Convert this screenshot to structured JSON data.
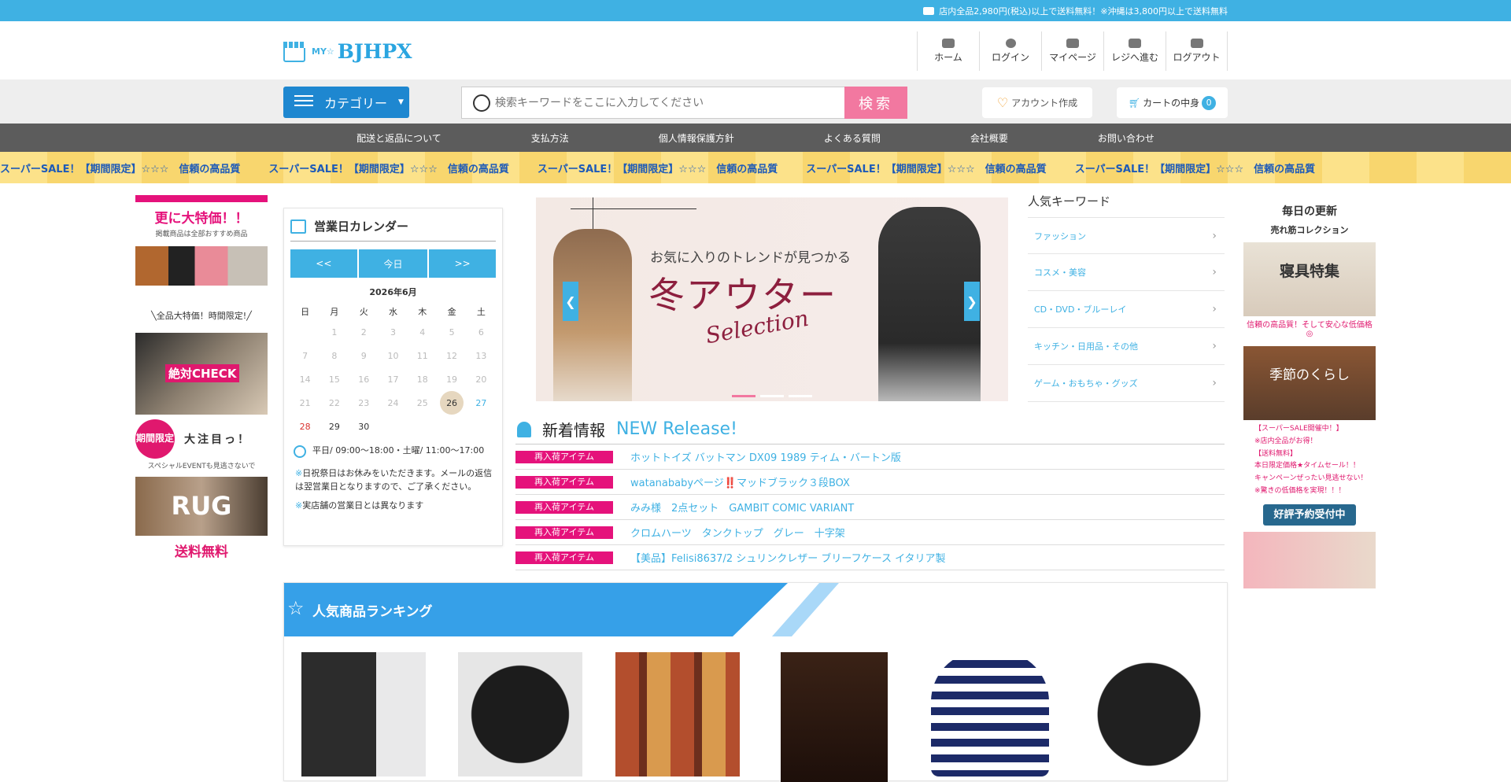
{
  "topbar": {
    "text": "店内全品2,980円(税込)以上で送料無料！※沖縄は3,800円以上で送料無料"
  },
  "header": {
    "logo_prefix": "MY☆",
    "logo_name": "BJHPX",
    "nav": [
      {
        "label": "ホーム",
        "icon": "home-icon"
      },
      {
        "label": "ログイン",
        "icon": "user-icon"
      },
      {
        "label": "マイページ",
        "icon": "id-card-icon"
      },
      {
        "label": "レジへ進む",
        "icon": "register-icon"
      },
      {
        "label": "ログアウト",
        "icon": "logout-icon"
      }
    ]
  },
  "search": {
    "category_label": "カテゴリー",
    "placeholder": "検索キーワードをここに入力してください",
    "button": "検索",
    "account": "アカウント作成",
    "cart": "カートの中身",
    "cart_count": "0"
  },
  "gnav": [
    "配送と返品について",
    "支払方法",
    "個人情報保護方針",
    "よくある質問",
    "会社概要",
    "お問い合わせ"
  ],
  "strip": {
    "text": "スーパーSALE！【期間限定】☆☆☆　信頼の高品質"
  },
  "left": {
    "sale_title": "更に大特価！！",
    "sale_sub": "掲載商品は全部おすすめ商品",
    "label2": "╲全品大特価！時間限定!╱",
    "stamp": "絶対CHECK",
    "limited": "期間限定",
    "attention": "大注目っ！",
    "event": "スペシャルEVENTも見逃さないで",
    "rug": "RUG",
    "ship": "送料無料"
  },
  "calendar": {
    "title": "営業日カレンダー",
    "prev": "<<",
    "today": "今日",
    "next": ">>",
    "month": "2026年6月",
    "dow": [
      "日",
      "月",
      "火",
      "水",
      "木",
      "金",
      "土"
    ],
    "hours": "平日/ 09:00～18:00・土曜/ 11:00～17:00",
    "note1_mark": "※",
    "note1": "日祝祭日はお休みをいただきます。メールの返信は翌営業日となりますので、ご了承ください。",
    "note2_mark": "※",
    "note2": "実店舗の営業日とは異なります"
  },
  "slider": {
    "catch": "お気に入りのトレンドが見つかる",
    "main": "冬アウター",
    "sub": "Selection",
    "prev": "❮",
    "next": "❯"
  },
  "keywords": {
    "title": "人気キーワード",
    "items": [
      "ファッション",
      "コスメ・美容",
      "CD・DVD・ブルーレイ",
      "キッチン・日用品・その他",
      "ゲーム・おもちゃ・グッズ"
    ]
  },
  "news": {
    "title_jp": "新着情報",
    "title_en": "NEW Release!",
    "items": [
      {
        "tag": "再入荷アイテム",
        "text": "ホットトイズ バットマン DX09 1989 ティム・バートン版"
      },
      {
        "tag": "再入荷アイテム",
        "text": "watanababyページ‼️マッドブラック３段BOX"
      },
      {
        "tag": "再入荷アイテム",
        "text": "みみ様　2点セット　GAMBIT COMIC VARIANT"
      },
      {
        "tag": "再入荷アイテム",
        "text": "クロムハーツ　タンクトップ　グレー　十字架"
      },
      {
        "tag": "再入荷アイテム",
        "text": "【美品】Felisi8637/2 シュリンクレザー ブリーフケース イタリア製"
      }
    ]
  },
  "right": {
    "title1": "毎日の更新",
    "title2": "売れ筋コレクション",
    "bedding": "寝具特集",
    "bedding_cap": "信頼の高品質！そして安心な低価格◎",
    "season": "季節のくらし",
    "notes": [
      "【スーパーSALE開催中！】",
      "※店内全品がお得！",
      "【送料無料】",
      "本日限定価格★タイムセール！！",
      "キャンペーンぜったい見逃せない！",
      "※驚きの低価格を実現！！！"
    ],
    "reserve": "好評予約受付中"
  },
  "ranking": {
    "title": "人気商品ランキング"
  }
}
